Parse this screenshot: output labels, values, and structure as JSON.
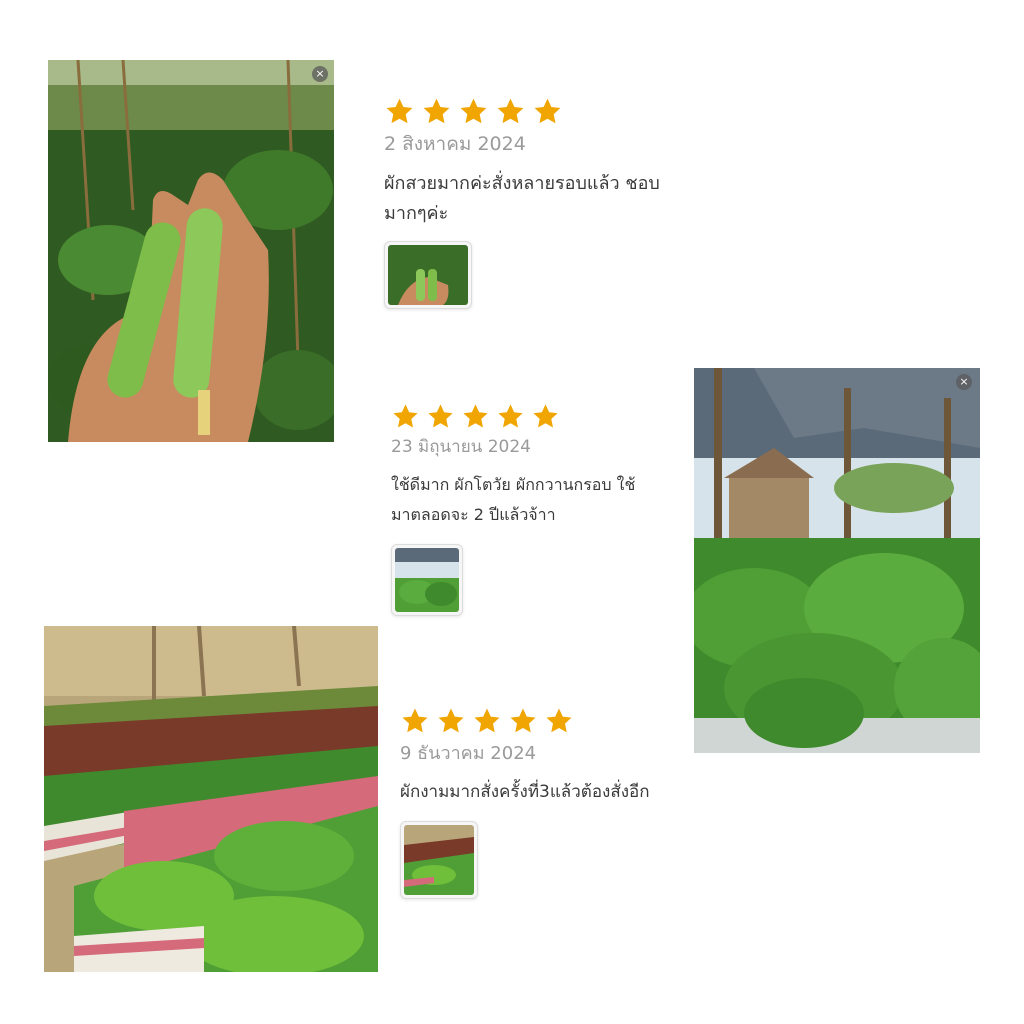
{
  "colors": {
    "star": "#f0a500",
    "date": "#9a9a9a",
    "text": "#3a3a3a"
  },
  "icons": {
    "close": "×",
    "star": "star-icon"
  },
  "reviews": [
    {
      "rating": 5,
      "date": "2 สิงหาคม 2024",
      "text_line1": "ผักสวยมากค่ะสั่งหลายรอบแล้ว ชอบ",
      "text_line2": "มากๆค่ะ",
      "photo": "cucumbers-in-hand"
    },
    {
      "rating": 5,
      "date": "23 มิถุนายน 2024",
      "text_line1": "ใช้ดีมาก ผักโตวัย ผักกวานกรอบ ใช้",
      "text_line2": "มาตลอดจะ 2 ปีแล้วจ้าา",
      "photo": "cos-lettuce-greenhouse"
    },
    {
      "rating": 5,
      "date": "9 ธันวาคม 2024",
      "text_line1": "ผักงามมากสั่งครั้งที่3แล้วต้องสั่งอีก",
      "text_line2": "",
      "photo": "lettuce-foam-boxes"
    }
  ]
}
